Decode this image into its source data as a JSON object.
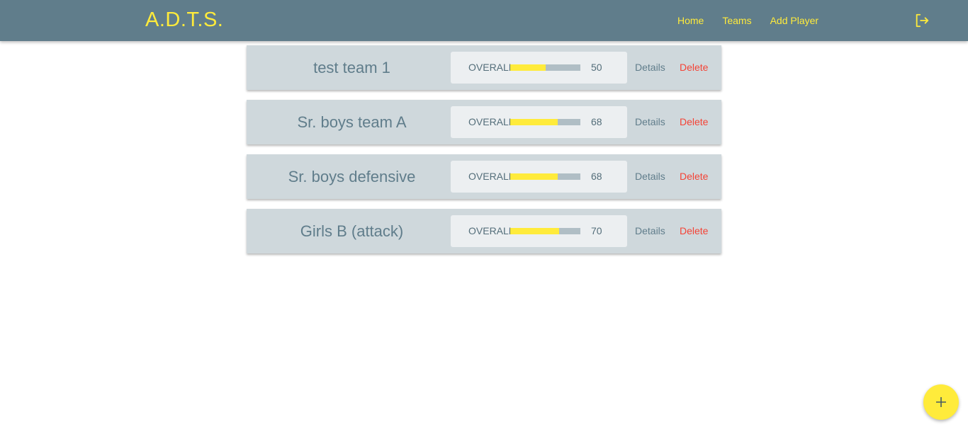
{
  "app": {
    "brand": "A.D.T.S."
  },
  "nav": {
    "items": [
      {
        "label": "Home"
      },
      {
        "label": "Teams"
      },
      {
        "label": "Add Player"
      }
    ],
    "logout_icon": "logout-icon"
  },
  "teams": [
    {
      "name": "test team 1",
      "stat_label": "OVERALL",
      "overall": 50,
      "details_label": "Details",
      "delete_label": "Delete"
    },
    {
      "name": "Sr. boys team A",
      "stat_label": "OVERALL",
      "overall": 68,
      "details_label": "Details",
      "delete_label": "Delete"
    },
    {
      "name": "Sr. boys defensive",
      "stat_label": "OVERALL",
      "overall": 68,
      "details_label": "Details",
      "delete_label": "Delete"
    },
    {
      "name": "Girls B (attack)",
      "stat_label": "OVERALL",
      "overall": 70,
      "details_label": "Details",
      "delete_label": "Delete"
    }
  ],
  "fab": {
    "icon": "plus-icon"
  },
  "colors": {
    "navbar": "#607d8b",
    "accent": "#ffeb3b",
    "card": "#cfd8dc",
    "stat_box": "#eceff1",
    "bar_track": "#b0bec5",
    "danger": "#f44336"
  }
}
